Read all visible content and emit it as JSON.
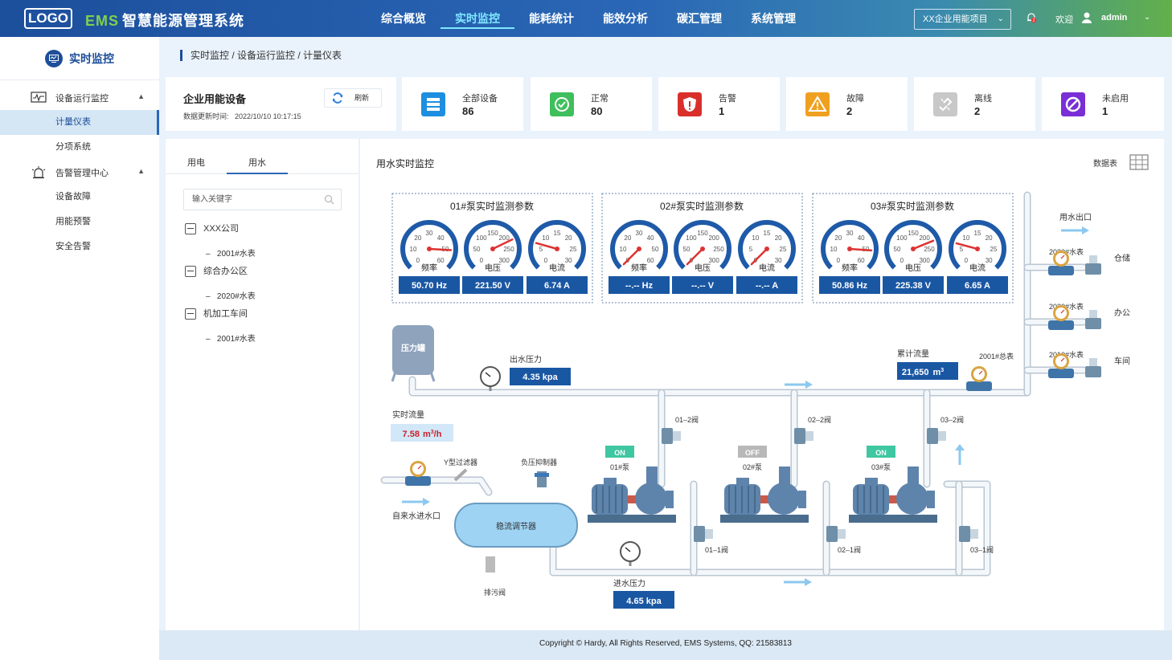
{
  "header": {
    "logo": "LOGO",
    "app_title_prefix": "EMS",
    "app_title": "智慧能源管理系统",
    "nav": [
      "综合概览",
      "实时监控",
      "能耗统计",
      "能效分析",
      "碳汇管理",
      "系统管理"
    ],
    "active_nav": "实时监控",
    "project": "XX企业用能项目",
    "notification_count": "2",
    "welcome": "欢迎",
    "user": "admin"
  },
  "sidebar": {
    "title": "实时监控",
    "groups": [
      {
        "label": "设备运行监控",
        "items": [
          "计量仪表",
          "分项系统"
        ]
      },
      {
        "label": "告警管理中心",
        "items": [
          "设备故障",
          "用能预警",
          "安全告警"
        ]
      }
    ],
    "active_item": "计量仪表"
  },
  "breadcrumb": "实时监控 / 设备运行监控 / 计量仪表",
  "summary": {
    "title": "企业用能设备",
    "updated_label": "数据更新时间:",
    "updated_time": "2022/10/10 10:17:15",
    "refresh_label": "刷新",
    "stats": [
      {
        "label": "全部设备",
        "value": "86",
        "color": "#1e8fe0",
        "icon": "server-icon"
      },
      {
        "label": "正常",
        "value": "80",
        "color": "#3fbf5c",
        "icon": "check-circle-icon"
      },
      {
        "label": "告警",
        "value": "1",
        "color": "#d9302c",
        "icon": "shield-alert-icon"
      },
      {
        "label": "故障",
        "value": "2",
        "color": "#f0a020",
        "icon": "warning-triangle-icon"
      },
      {
        "label": "离线",
        "value": "2",
        "color": "#c8c8c8",
        "icon": "broken-link-icon"
      },
      {
        "label": "未启用",
        "value": "1",
        "color": "#7a2ed6",
        "icon": "forbidden-icon"
      }
    ]
  },
  "tree_panel": {
    "tabs": [
      "用电",
      "用水"
    ],
    "active_tab": "用水",
    "search_placeholder": "输入关键字",
    "nodes": [
      {
        "label": "XXX公司",
        "children": [
          "2001#水表"
        ]
      },
      {
        "label": "综合办公区",
        "children": [
          "2020#水表"
        ]
      },
      {
        "label": "机加工车间",
        "children": [
          "2001#水表"
        ]
      }
    ]
  },
  "monitor": {
    "title": "用水实时监控",
    "data_table_label": "数据表",
    "pumps": [
      {
        "title": "01#泵实时监测参数",
        "gauges": [
          {
            "label": "频率",
            "ticks": [
              "0",
              "10",
              "20",
              "30",
              "40",
              "50",
              "60"
            ],
            "value": "50.70 Hz",
            "fraction": 0.845
          },
          {
            "label": "电压",
            "ticks": [
              "0",
              "50",
              "100",
              "150",
              "200",
              "250",
              "300"
            ],
            "value": "221.50 V",
            "fraction": 0.738
          },
          {
            "label": "电流",
            "ticks": [
              "0",
              "5",
              "10",
              "15",
              "20",
              "25",
              "30"
            ],
            "value": "6.74 A",
            "fraction": 0.225
          }
        ]
      },
      {
        "title": "02#泵实时监测参数",
        "gauges": [
          {
            "label": "频率",
            "ticks": [
              "0",
              "10",
              "20",
              "30",
              "40",
              "50",
              "60"
            ],
            "value": "--.-- Hz",
            "fraction": 0
          },
          {
            "label": "电压",
            "ticks": [
              "0",
              "50",
              "100",
              "150",
              "200",
              "250",
              "300"
            ],
            "value": "--.-- V",
            "fraction": 0
          },
          {
            "label": "电流",
            "ticks": [
              "0",
              "5",
              "10",
              "15",
              "20",
              "25",
              "30"
            ],
            "value": "--.-- A",
            "fraction": 0
          }
        ]
      },
      {
        "title": "03#泵实时监测参数",
        "gauges": [
          {
            "label": "频率",
            "ticks": [
              "0",
              "10",
              "20",
              "30",
              "40",
              "50",
              "60"
            ],
            "value": "50.86 Hz",
            "fraction": 0.848
          },
          {
            "label": "电压",
            "ticks": [
              "0",
              "50",
              "100",
              "150",
              "200",
              "250",
              "300"
            ],
            "value": "225.38 V",
            "fraction": 0.751
          },
          {
            "label": "电流",
            "ticks": [
              "0",
              "5",
              "10",
              "15",
              "20",
              "25",
              "30"
            ],
            "value": "6.65 A",
            "fraction": 0.222
          }
        ]
      }
    ],
    "pressure_tank": "压力罐",
    "outlet_pressure_label": "出水压力",
    "outlet_pressure": "4.35 kpa",
    "cumulative_flow_label": "累计流量",
    "cumulative_flow": "21,650",
    "cumulative_flow_unit": "m",
    "cumulative_flow_unit_sup": "3",
    "main_meter": "2001#总表",
    "realtime_flow_label": "实时流量",
    "realtime_flow": "7.58",
    "realtime_flow_unit": "m",
    "realtime_flow_unit_sup": "3",
    "realtime_flow_unit_tail": "/h",
    "y_filter": "Y型过滤器",
    "suppressor": "负压抑制器",
    "inlet": "自来水进水口",
    "buffer_tank": "稳流调节器",
    "drain": "排污阀",
    "inlet_pressure_label": "进水压力",
    "inlet_pressure": "4.65 kpa",
    "outlet_label": "用水出口",
    "pump_status": [
      {
        "name": "01#泵",
        "state": "ON"
      },
      {
        "name": "02#泵",
        "state": "OFF"
      },
      {
        "name": "03#泵",
        "state": "ON"
      }
    ],
    "valves_upper": [
      "01–2阀",
      "02–2阀",
      "03–2阀"
    ],
    "valves_lower": [
      "01–1阀",
      "02–1阀",
      "03–1阀"
    ],
    "branches": [
      {
        "meter": "2030#水表",
        "dest": "仓储"
      },
      {
        "meter": "2020#水表",
        "dest": "办公"
      },
      {
        "meter": "2010#水表",
        "dest": "车间"
      }
    ]
  },
  "footer": "Copyright © Hardy, All Rights Reserved,  EMS Systems,  QQ:  21583813"
}
